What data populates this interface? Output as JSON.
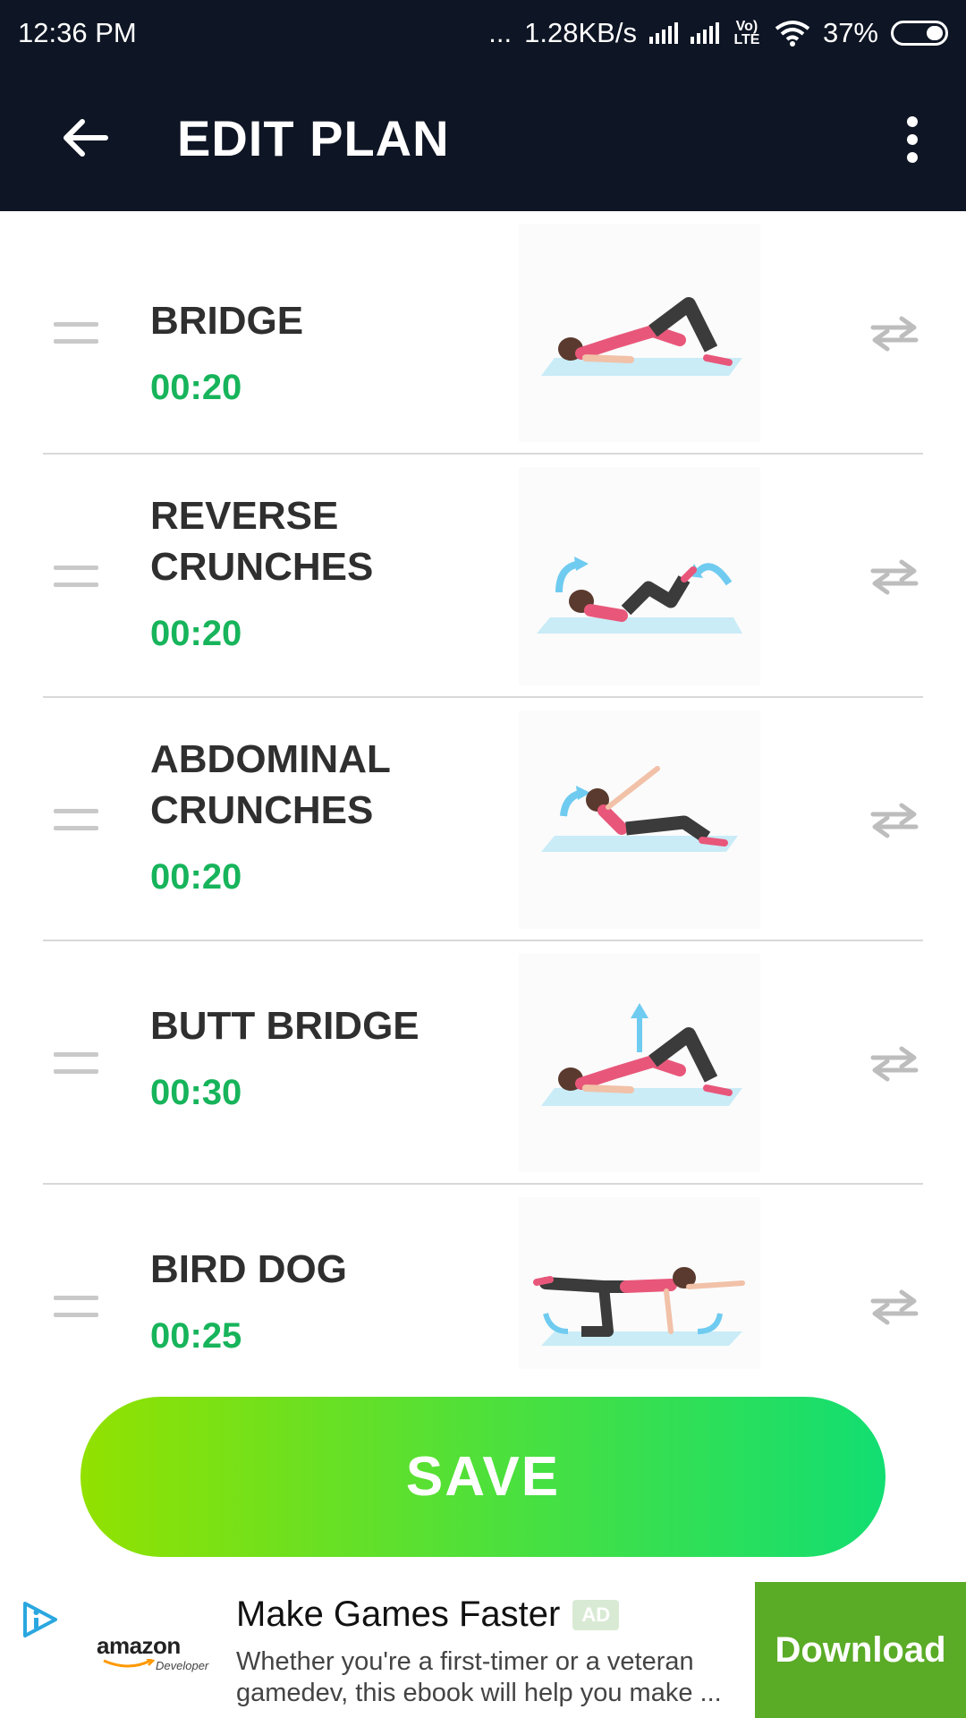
{
  "status_bar": {
    "time": "12:36 PM",
    "dots": "...",
    "speed": "1.28KB/s",
    "volte": "Vo) LTE",
    "battery": "37%"
  },
  "app_bar": {
    "title": "EDIT PLAN"
  },
  "exercises": [
    {
      "name": "BRIDGE",
      "time": "00:20",
      "illustration": "bridge-pose"
    },
    {
      "name": "REVERSE CRUNCHES",
      "time": "00:20",
      "illustration": "reverse-crunch-pose"
    },
    {
      "name": "ABDOMINAL CRUNCHES",
      "time": "00:20",
      "illustration": "abdominal-crunch-pose"
    },
    {
      "name": "BUTT BRIDGE",
      "time": "00:30",
      "illustration": "butt-bridge-pose"
    },
    {
      "name": "BIRD DOG",
      "time": "00:25",
      "illustration": "bird-dog-pose"
    }
  ],
  "save_label": "SAVE",
  "ad": {
    "brand": "amazon",
    "brand_sub": "Developer",
    "title": "Make Games Faster",
    "badge": "AD",
    "description": "Whether you're a first-timer or a veteran gamedev, this ebook will help you make ...",
    "cta": "Download"
  },
  "colors": {
    "header_bg": "#0e1524",
    "time_green": "#17b45b",
    "save_gradient_start": "#92e100",
    "save_gradient_end": "#12de72",
    "download_bg": "#5aab26"
  }
}
